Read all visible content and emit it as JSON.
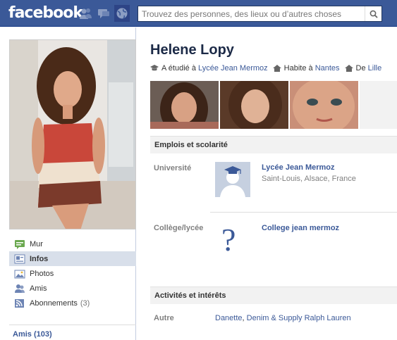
{
  "topbar": {
    "logo": "facebook",
    "search_placeholder": "Trouvez des personnes, des lieux ou d’autres choses"
  },
  "left_nav": {
    "items": [
      {
        "label": "Mur",
        "icon": "wall-icon"
      },
      {
        "label": "Infos",
        "icon": "info-icon"
      },
      {
        "label": "Photos",
        "icon": "photos-icon"
      },
      {
        "label": "Amis",
        "icon": "friends-icon"
      },
      {
        "label": "Abonnements",
        "count": "(3)",
        "icon": "subscriptions-icon"
      }
    ],
    "friends_heading": "Amis (103)"
  },
  "profile": {
    "name": "Helene Lopy",
    "studied_prefix": "A étudié à",
    "studied_school": "Lycée Jean Mermoz",
    "lives_prefix": "Habite à",
    "lives_city": "Nantes",
    "from_prefix": "De",
    "from_city": "Lille"
  },
  "sections": {
    "work_education": {
      "heading": "Emplois et scolarité",
      "university_label": "Université",
      "university_name": "Lycée Jean Mermoz",
      "university_location": "Saint-Louis, Alsace, France",
      "highschool_label": "Collège/lycée",
      "highschool_name": "College jean mermoz"
    },
    "activities": {
      "heading": "Activités et intérêts",
      "other_label": "Autre",
      "other_item_1": "Danette",
      "separator": ",",
      "other_item_2": "Denim & Supply Ralph Lauren"
    }
  },
  "colors": {
    "brand_blue": "#3b5998",
    "nav_active_bg": "#d8dfea"
  }
}
